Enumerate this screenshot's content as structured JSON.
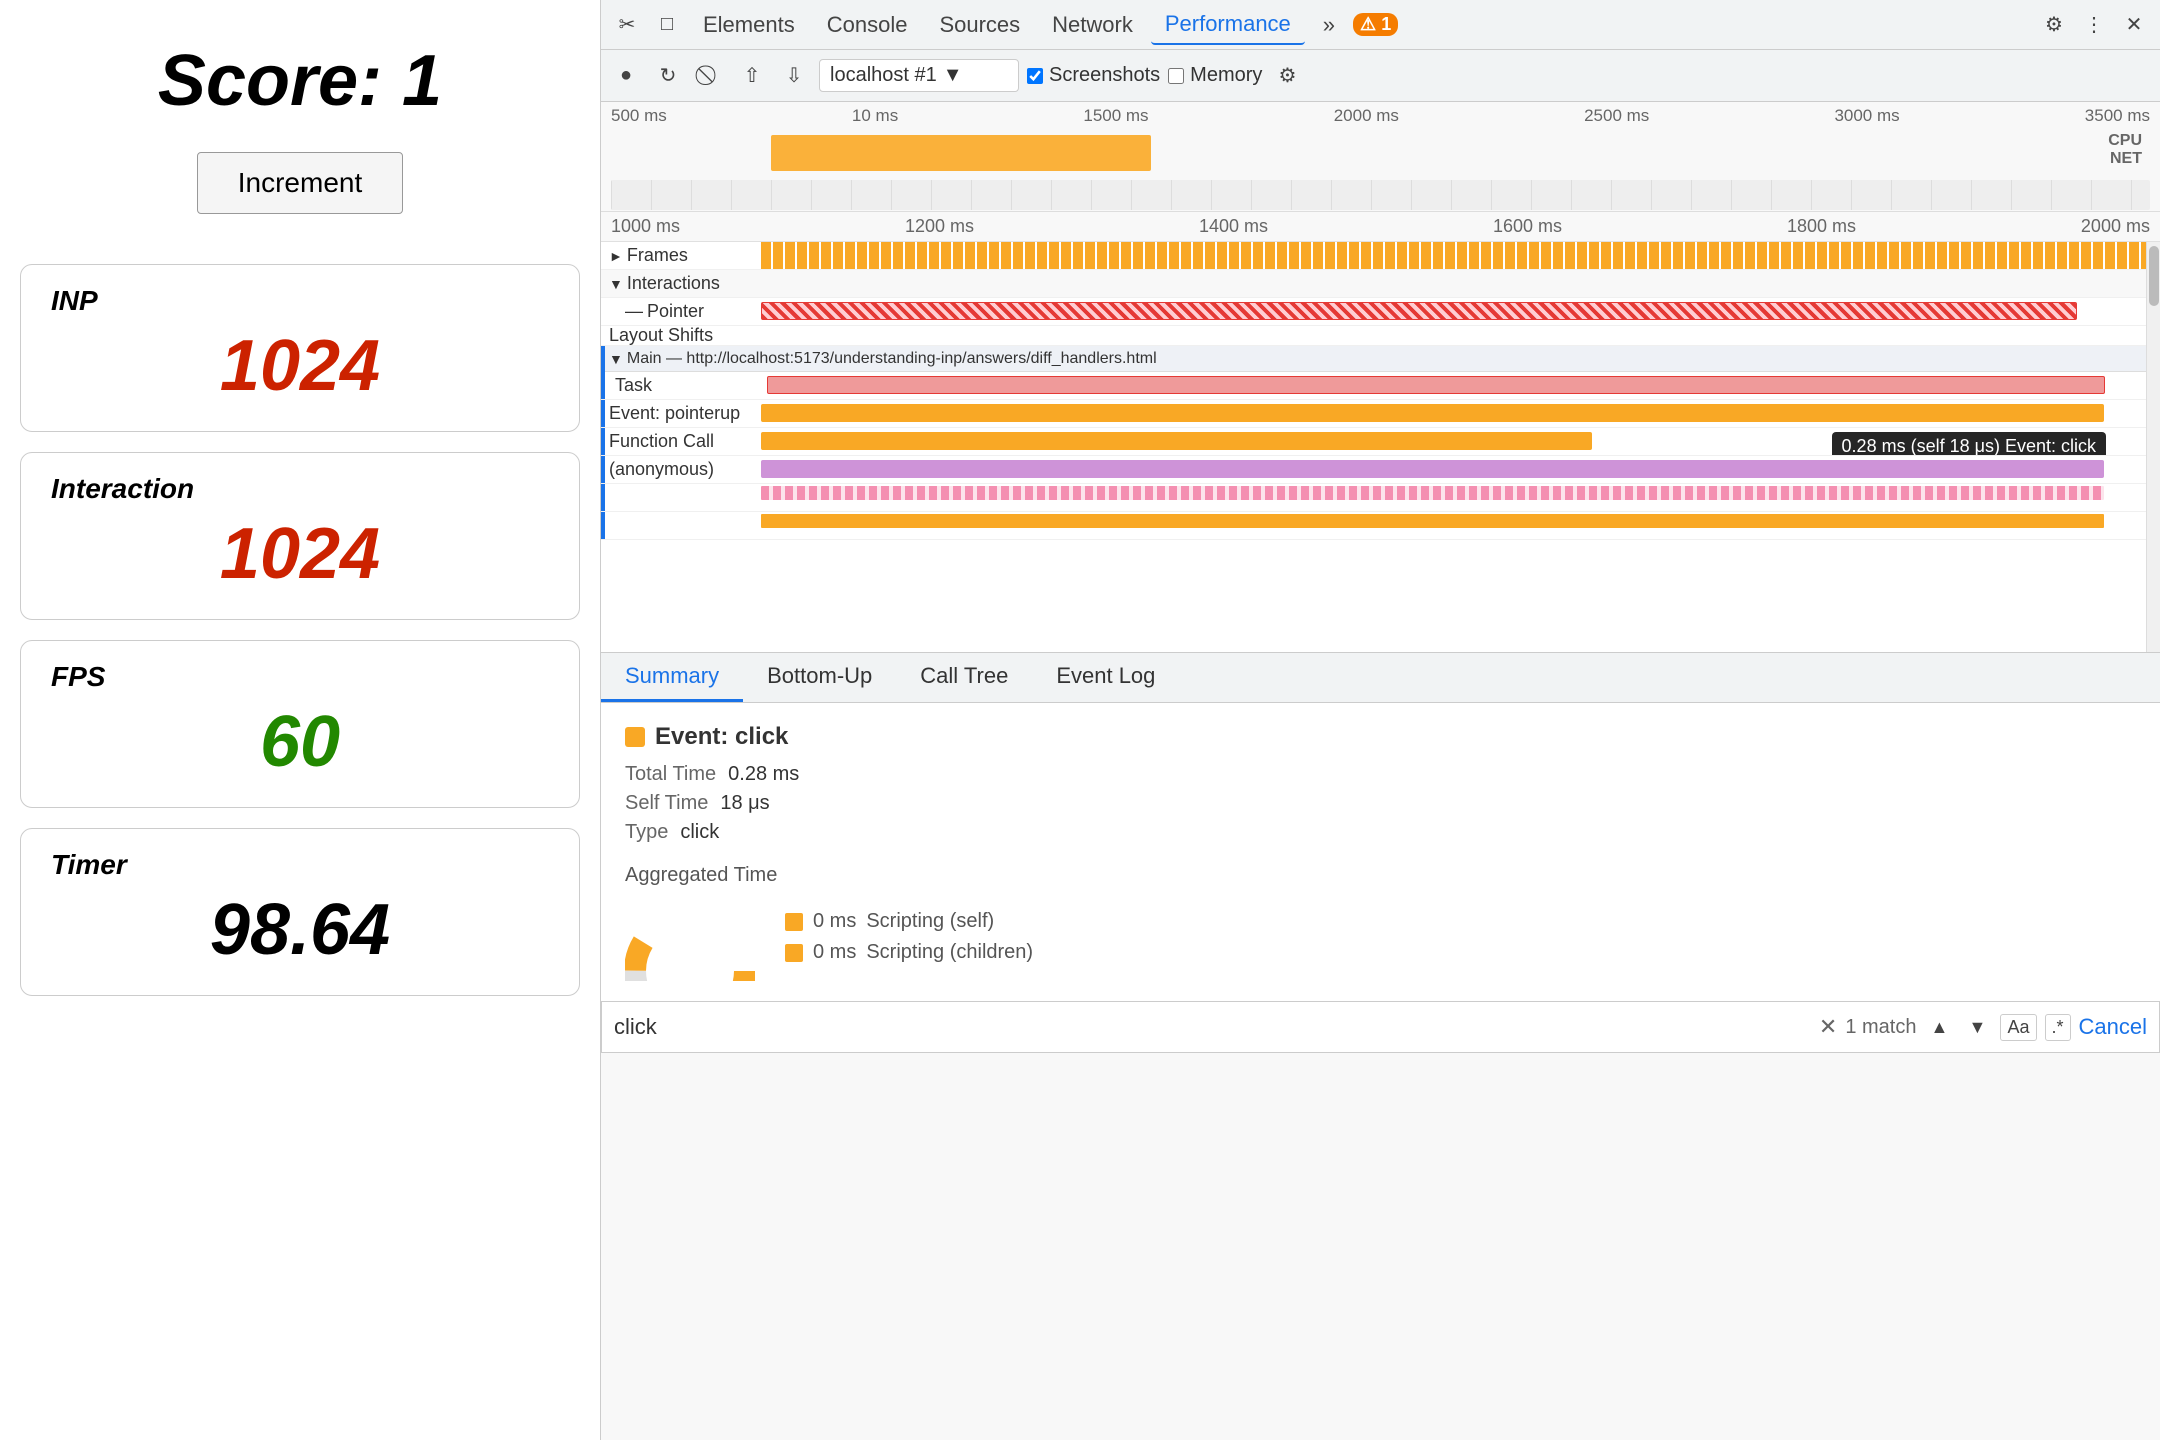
{
  "left": {
    "score_label": "Score:",
    "score_value": "1",
    "increment_btn": "Increment",
    "inp_label": "INP",
    "inp_value": "1024",
    "interaction_label": "Interaction",
    "interaction_value": "1024",
    "fps_label": "FPS",
    "fps_value": "60",
    "timer_label": "Timer",
    "timer_value": "98.64"
  },
  "devtools": {
    "tabs": [
      {
        "label": "Elements",
        "active": false
      },
      {
        "label": "Console",
        "active": false
      },
      {
        "label": "Sources",
        "active": false
      },
      {
        "label": "Network",
        "active": false
      },
      {
        "label": "Performance",
        "active": true
      }
    ],
    "warning_count": "1",
    "url": "localhost #1",
    "screenshots_label": "Screenshots",
    "memory_label": "Memory",
    "time_markers_overview": [
      "500 ms",
      "10 ms",
      "1500 ms",
      "2000 ms",
      "2500 ms",
      "3000 ms",
      "3500 ms"
    ],
    "cpu_label": "CPU",
    "net_label": "NET",
    "time_markers_main": [
      "1000 ms",
      "1200 ms",
      "1400 ms",
      "1600 ms",
      "1800 ms",
      "2000 ms"
    ],
    "frames_label": "Frames",
    "interactions_label": "Interactions",
    "pointer_label": "Pointer",
    "layout_shifts_label": "Layout Shifts",
    "main_section_label": "Main — http://localhost:5173/understanding-inp/answers/diff_handlers.html",
    "task_label": "Task",
    "event_pointerup_label": "Event: pointerup",
    "function_call_label": "Function Call",
    "anonymous_label": "(anonymous)",
    "tooltip_text": "0.28 ms (self 18 μs)  Event: click",
    "bottom_tabs": [
      "Summary",
      "Bottom-Up",
      "Call Tree",
      "Event Log"
    ],
    "active_bottom_tab": "Summary",
    "event_click_label": "Event: click",
    "total_time_label": "Total Time",
    "total_time_value": "0.28 ms",
    "self_time_label": "Self Time",
    "self_time_value": "18 μs",
    "type_label": "Type",
    "type_value": "click",
    "aggregated_label": "Aggregated Time",
    "scripting_self_label": "Scripting (self)",
    "scripting_self_value": "0 ms",
    "scripting_children_label": "Scripting (children)",
    "scripting_children_value": "0 ms",
    "search_placeholder": "click",
    "search_match": "1 match",
    "cancel_label": "Cancel"
  }
}
